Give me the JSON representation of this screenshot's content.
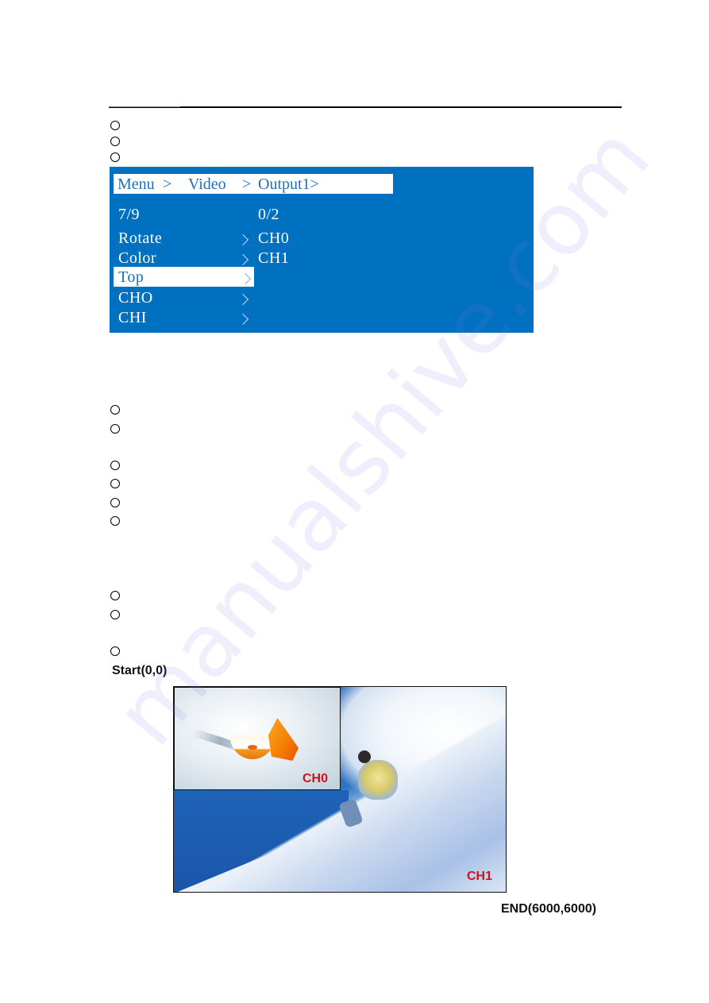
{
  "page": {
    "watermark": "manualshive.com"
  },
  "osd_menu": {
    "breadcrumb": [
      "Menu",
      ">",
      "Video",
      ">",
      "Output1>"
    ],
    "left_column": {
      "counter": "7/9",
      "items": [
        {
          "label": "Rotate",
          "selected": false
        },
        {
          "label": "Color",
          "selected": false
        },
        {
          "label": "Top",
          "selected": true
        },
        {
          "label": "CHO",
          "selected": false
        },
        {
          "label": "CHI",
          "selected": false
        }
      ]
    },
    "right_column": {
      "counter": "0/2",
      "items": [
        "CH0",
        "CH1"
      ]
    },
    "colors": {
      "panel_bg": "#0070c0",
      "highlight_bg": "#ffffff",
      "highlight_text": "#1f6fbf",
      "text": "#ffffff"
    }
  },
  "illustration": {
    "start_label": "Start(0,0)",
    "end_label": "END(6000,6000)",
    "channel_labels": {
      "inset": "CH0",
      "background": "CH1"
    },
    "label_color": "#d0121b"
  }
}
